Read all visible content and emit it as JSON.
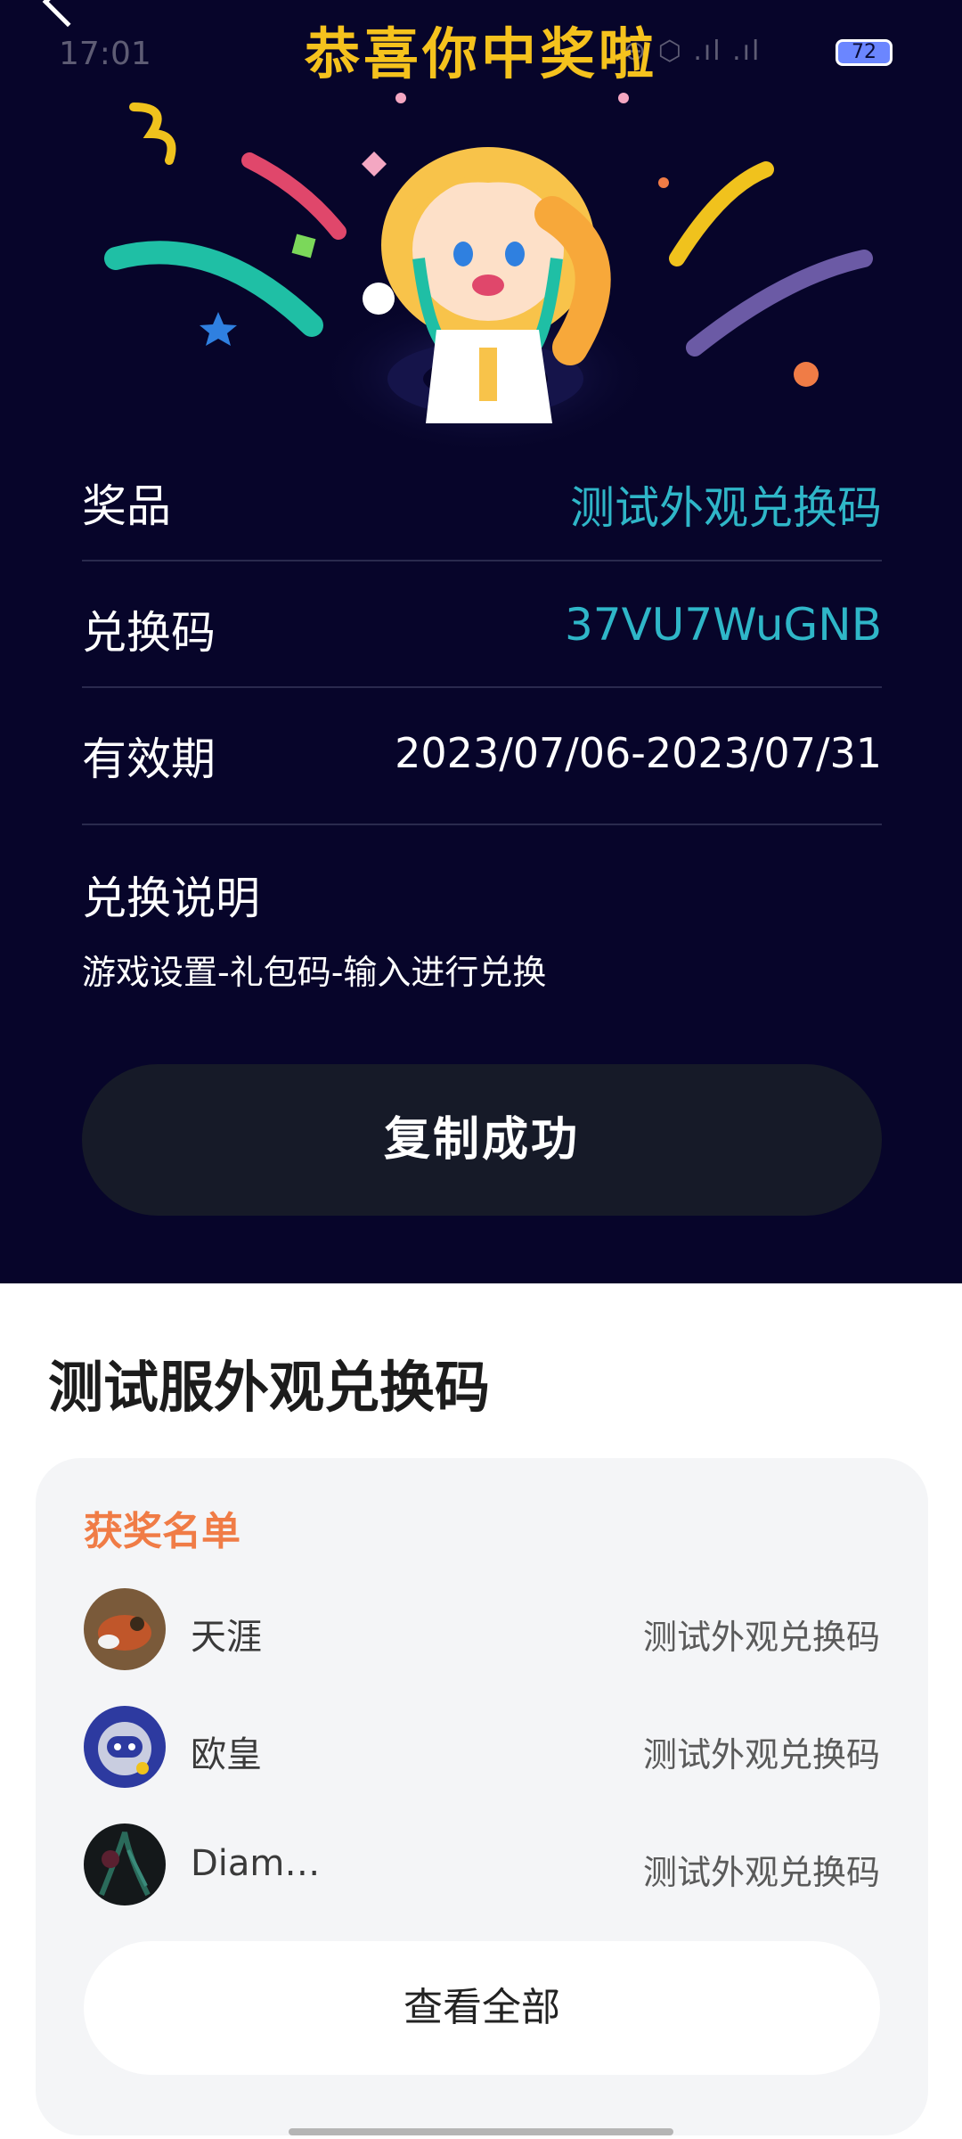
{
  "status_bar": {
    "time": "17:01",
    "network": "⊕ ⬡ .ıl .ıl",
    "battery": "72"
  },
  "banner": {
    "title": "恭喜你中奖啦"
  },
  "details": {
    "prize_label": "奖品",
    "prize_value": "测试外观兑换码",
    "code_label": "兑换码",
    "code_value": "37VU7WuGNB",
    "validity_label": "有效期",
    "validity_value": "2023/07/06-2023/07/31",
    "instruction_title": "兑换说明",
    "instruction_text": "游戏设置-礼包码-输入进行兑换"
  },
  "copy_button": {
    "label": "复制成功"
  },
  "event": {
    "title": "测试服外观兑换码"
  },
  "winners": {
    "title": "获奖名单",
    "list": [
      {
        "name": "天涯",
        "prize": "测试外观兑换码"
      },
      {
        "name": "欧皇",
        "prize": "测试外观兑换码"
      },
      {
        "name": "Diam…",
        "prize": "测试外观兑换码"
      }
    ],
    "view_all_label": "查看全部"
  },
  "colors": {
    "dark_bg": "#07052a",
    "accent_teal": "#2fb6c8",
    "title_gold": "#f5c21d",
    "winners_orange": "#f07c46",
    "button_dark": "#161a28"
  }
}
